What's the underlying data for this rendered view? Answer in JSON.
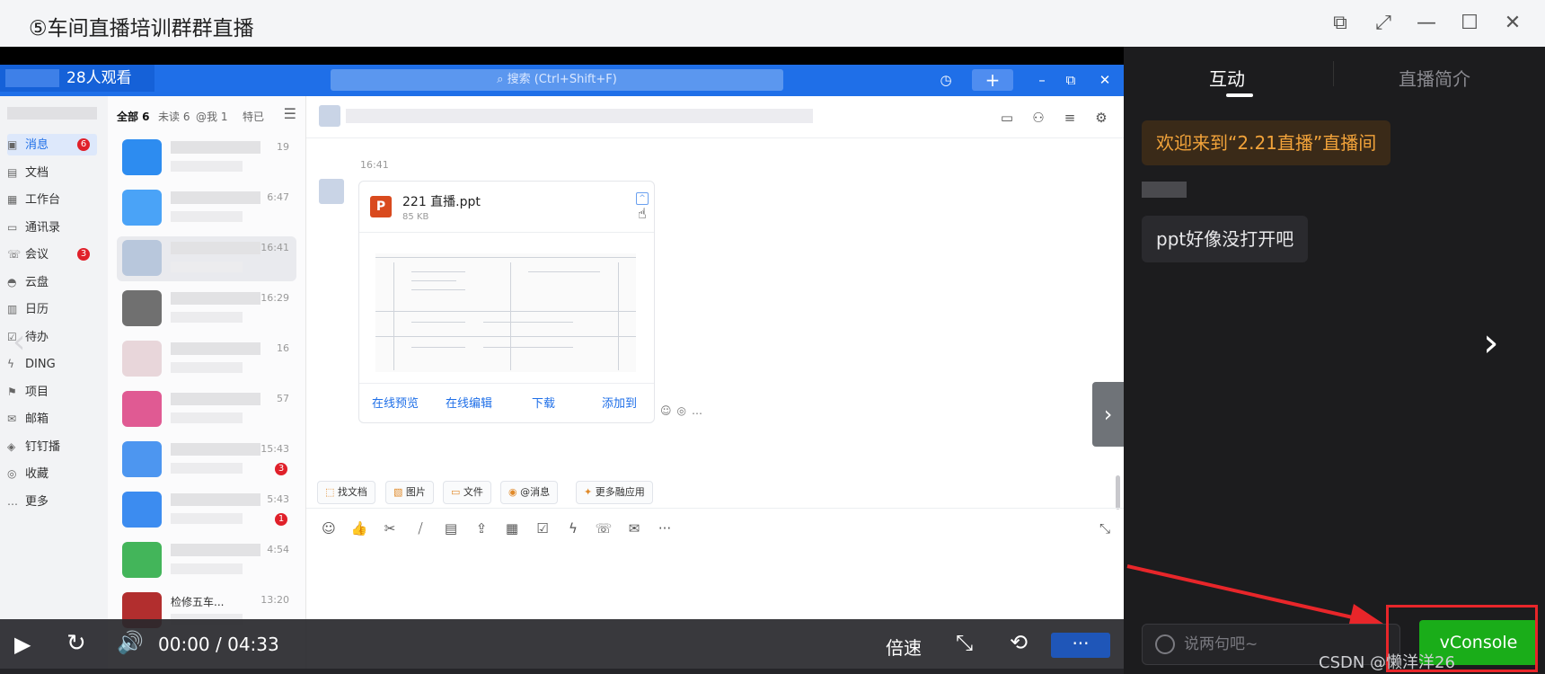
{
  "window": {
    "title": "⑤车间直播培训群群直播"
  },
  "app": {
    "live_badge": "28人观看",
    "search_placeholder": "搜索 (Ctrl+Shift+F)",
    "nav_items": [
      {
        "label": "消息",
        "badge": "6"
      },
      {
        "label": "文档",
        "badge": ""
      },
      {
        "label": "工作台",
        "badge": ""
      },
      {
        "label": "通讯录",
        "badge": ""
      },
      {
        "label": "会议",
        "badge": "3"
      },
      {
        "label": "云盘",
        "badge": ""
      },
      {
        "label": "日历",
        "badge": ""
      },
      {
        "label": "待办",
        "badge": ""
      },
      {
        "label": "DING",
        "badge": ""
      },
      {
        "label": "项目",
        "badge": ""
      },
      {
        "label": "邮箱",
        "badge": ""
      },
      {
        "label": "钉钉播",
        "badge": ""
      },
      {
        "label": "收藏",
        "badge": ""
      },
      {
        "label": "更多",
        "badge": ""
      }
    ],
    "list_tabs": [
      "全部 6",
      "未读 6",
      "@我 1",
      "特已"
    ],
    "chats": [
      {
        "time": "19",
        "badge": ""
      },
      {
        "time": "6:47",
        "badge": ""
      },
      {
        "time": "16:41",
        "badge": ""
      },
      {
        "time": "16:29",
        "badge": ""
      },
      {
        "time": "16",
        "badge": ""
      },
      {
        "time": "57",
        "badge": ""
      },
      {
        "time": "15:43",
        "badge": "3"
      },
      {
        "time": "5:43",
        "badge": "1"
      },
      {
        "time": "4:54",
        "badge": ""
      },
      {
        "time": "13:20",
        "badge": ""
      }
    ],
    "last_chat_name": "检修五车...",
    "message_time": "16:41",
    "file": {
      "name": "221 直播.ppt",
      "size": "85 KB"
    },
    "file_actions": [
      "在线预览",
      "在线编辑",
      "下载",
      "添加到"
    ],
    "quick_chips": [
      "找文档",
      "图片",
      "文件",
      "@消息",
      "更多融应用"
    ]
  },
  "player": {
    "time": "00:00 / 04:33",
    "speed_label": "倍速"
  },
  "panel": {
    "tabs": [
      "互动",
      "直播简介"
    ],
    "welcome": "欢迎来到“2.21直播”直播间",
    "message": "ppt好像没打开吧",
    "input_placeholder": "说两句吧~",
    "vconsole_label": "vConsole"
  },
  "watermark": "CSDN @懒洋洋26"
}
